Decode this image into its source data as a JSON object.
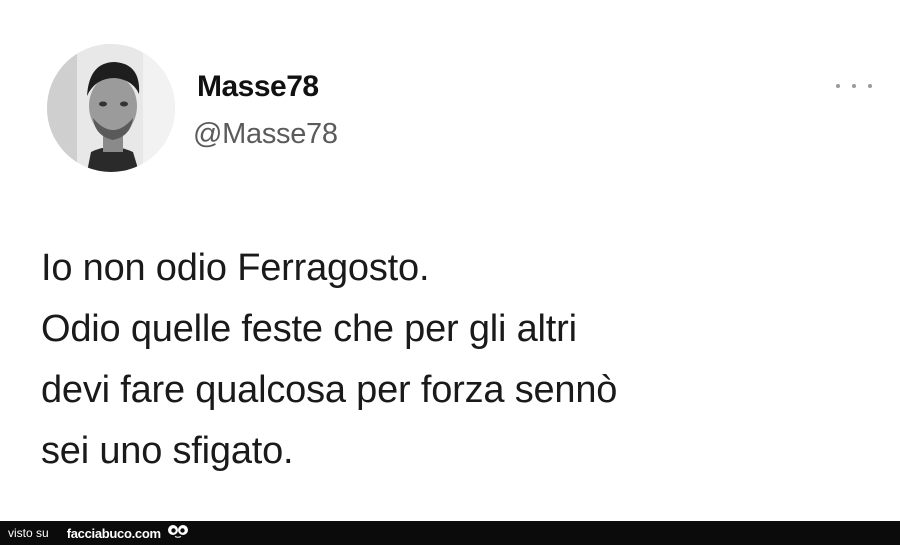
{
  "tweet": {
    "author_name": "Masse78",
    "author_handle": "@Masse78",
    "text_lines": [
      "Io non odio Ferragosto.",
      "Odio quelle feste che per gli altri",
      "devi fare qualcosa per forza sennò",
      "sei uno sfigato."
    ]
  },
  "footer": {
    "visto_label": "visto su",
    "site_name": "facciabuco.com"
  },
  "icons": {
    "more": "more-options-icon",
    "avatar": "avatar",
    "logo": "facciabuco-logo-icon"
  }
}
